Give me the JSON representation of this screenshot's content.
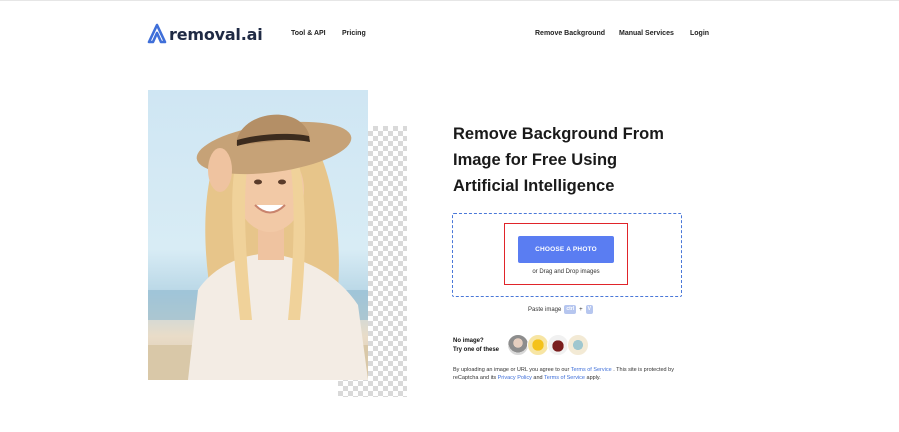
{
  "brand": {
    "name": "removal.ai",
    "accent": "#5a7df2",
    "logo_color": "#3f6fd9"
  },
  "nav": {
    "left": [
      "Tool & API",
      "Pricing"
    ],
    "right": [
      "Remove Background",
      "Manual Services",
      "Login"
    ]
  },
  "hero": {
    "line1": "Remove Background From",
    "line2": "Image for Free Using",
    "line3": "Artificial Intelligence"
  },
  "upload": {
    "button": "CHOOSE A PHOTO",
    "drag": "or Drag and Drop images",
    "paste": "Paste image",
    "key1": "ctrl",
    "plus": "+",
    "key2": "V"
  },
  "samples": {
    "line1": "No image?",
    "line2": "Try one of these",
    "icons": [
      "sample-woman",
      "sample-flower",
      "sample-jar",
      "sample-bottle"
    ]
  },
  "terms": {
    "t1": "By uploading an image or URL you agree to our ",
    "link1": "Terms of Service",
    "t2": " . This site is protected by reCaptcha and its ",
    "link2": "Privacy Policy",
    "t3": " and ",
    "link3": "Terms of Service",
    "t4": " apply."
  }
}
